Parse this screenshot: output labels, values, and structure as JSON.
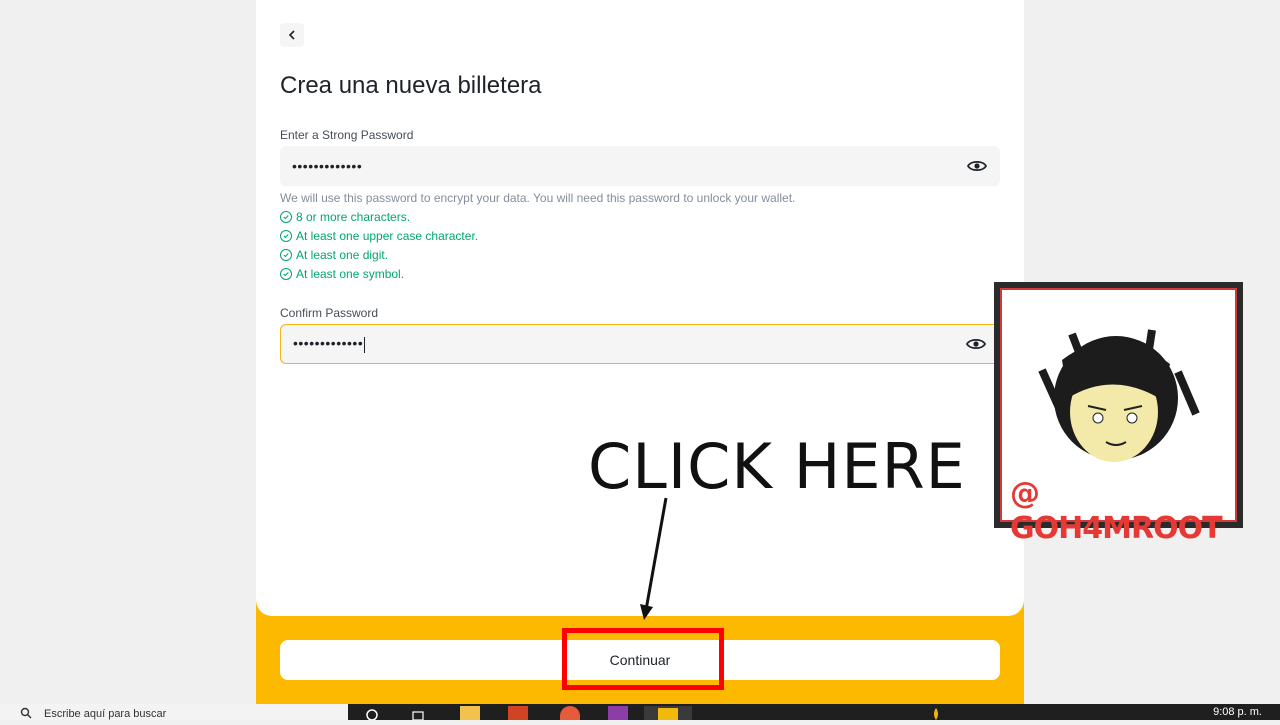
{
  "page": {
    "title": "Crea una nueva billetera",
    "back_label": "‹"
  },
  "password": {
    "label": "Enter a Strong Password",
    "value": "•••••••••••••",
    "hint": "We will use this password to encrypt your data. You will need this password to unlock your wallet.",
    "rules": [
      "8 or more characters.",
      "At least one upper case character.",
      "At least one digit.",
      "At least one symbol."
    ]
  },
  "confirm": {
    "label": "Confirm Password",
    "value": "•••••••••••••"
  },
  "actions": {
    "continue_label": "Continuar"
  },
  "annotation": {
    "callout": "CLICK HERE",
    "watermark": "@ GOH4MROOT"
  },
  "taskbar": {
    "search_text": "Escribe aquí para buscar",
    "time": "9:08 p. m."
  },
  "colors": {
    "accent": "#fcd535",
    "success": "#03a66d",
    "highlight": "#ff0000"
  }
}
